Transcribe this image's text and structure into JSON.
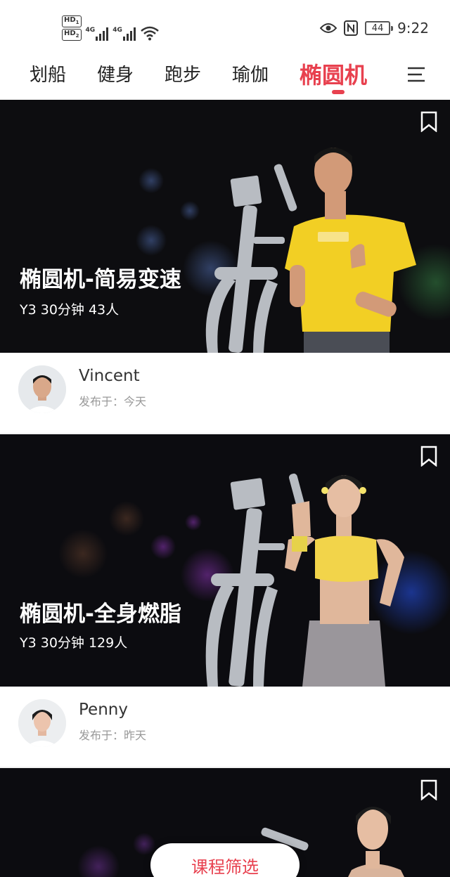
{
  "status_bar": {
    "hd1": "HD",
    "hd1_sub": "1",
    "hd2": "HD",
    "hd2_sub": "2",
    "net1": "4G",
    "net2": "4G",
    "battery": "44",
    "time": "9:22"
  },
  "tabs": {
    "items": [
      "划船",
      "健身",
      "跑步",
      "瑜伽",
      "椭圆机"
    ],
    "active_index": 4,
    "accent_color": "#e8414f"
  },
  "courses": [
    {
      "title": "椭圆机-简易变速",
      "meta": "Y3  30分钟  43人",
      "coach_name": "Vincent",
      "published": "发布于：今天"
    },
    {
      "title": "椭圆机-全身燃脂",
      "meta": "Y3  30分钟  129人",
      "coach_name": "Penny",
      "published": "发布于：昨天"
    },
    {
      "title": "",
      "meta": "",
      "coach_name": "",
      "published": ""
    }
  ],
  "filter_button": {
    "label": "课程筛选"
  },
  "icons": {
    "menu": "menu-icon",
    "bookmark": "bookmark-icon",
    "wifi": "wifi-icon",
    "eye": "eye-icon",
    "nfc": "nfc-icon"
  }
}
